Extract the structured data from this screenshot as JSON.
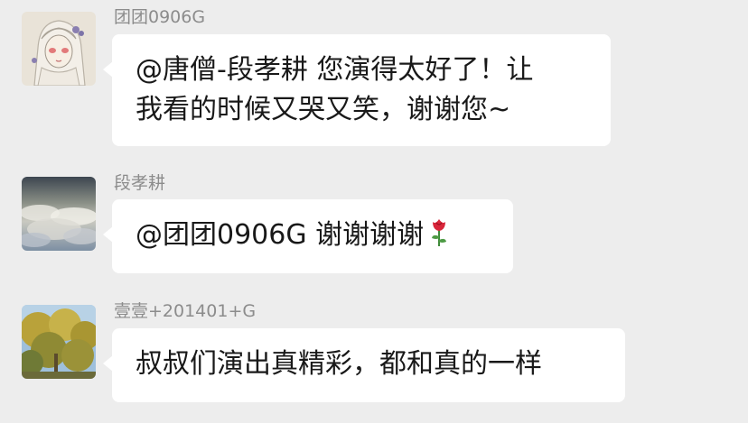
{
  "messages": [
    {
      "sender": "团团0906G",
      "avatar_icon": "anime-girl-avatar-icon",
      "lines": [
        "@唐僧-段孝耕 您演得太好了！让",
        "我看的时候又哭又笑，谢谢您~"
      ]
    },
    {
      "sender": "段孝耕",
      "avatar_icon": "cloud-sky-avatar-icon",
      "lines": [
        "@团团0906G 谢谢谢谢"
      ],
      "emoji": "rose-emoji"
    },
    {
      "sender": "壹壹+201401+G",
      "avatar_icon": "ginkgo-tree-avatar-icon",
      "lines": [
        "叔叔们演出真精彩，都和真的一样"
      ]
    }
  ],
  "colors": {
    "background": "#ededed",
    "bubble": "#ffffff",
    "sender_text": "#8c8c8c",
    "message_text": "#191919"
  }
}
